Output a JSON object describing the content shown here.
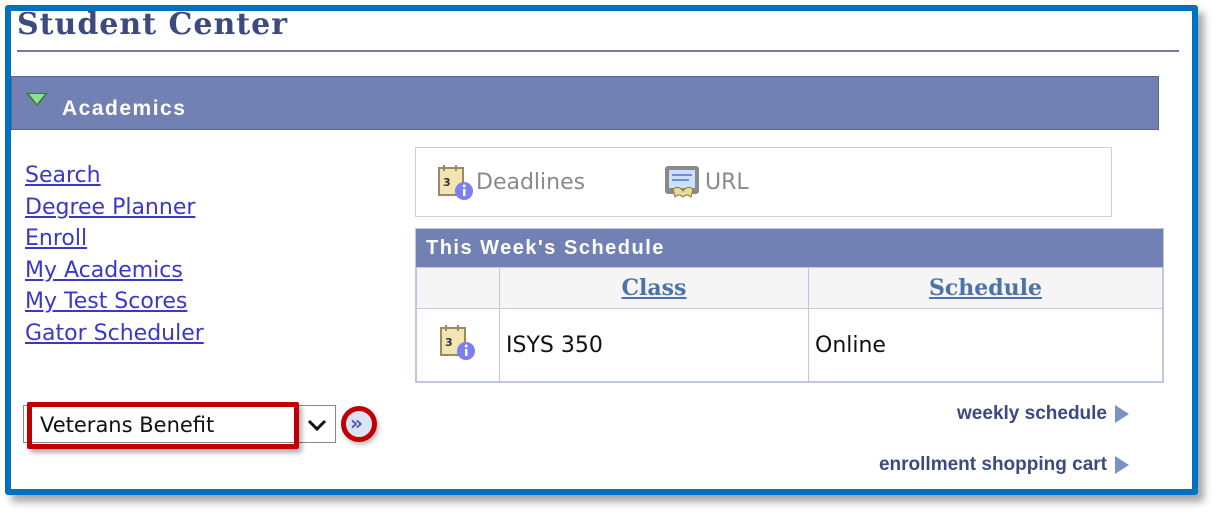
{
  "page": {
    "title": "Student Center"
  },
  "section": {
    "label": "Academics",
    "expanded": true
  },
  "links": [
    {
      "label": "Search"
    },
    {
      "label": "Degree Planner"
    },
    {
      "label": "Enroll"
    },
    {
      "label": "My Academics"
    },
    {
      "label": "My Test Scores"
    },
    {
      "label": "Gator Scheduler"
    }
  ],
  "other_academic": {
    "selected": "Veterans Benefit",
    "go_icon": "double-chevron-right-icon"
  },
  "toolbar": {
    "deadlines_label": "Deadlines",
    "url_label": "URL"
  },
  "schedule": {
    "title": "This Week's Schedule",
    "columns": [
      "",
      "Class",
      "Schedule"
    ],
    "rows": [
      {
        "icon": "calendar-info-icon",
        "class": "ISYS 350",
        "schedule": "Online"
      }
    ]
  },
  "footer": {
    "weekly_schedule": "weekly schedule",
    "shopping_cart": "enrollment shopping cart"
  },
  "colors": {
    "frame_border": "#0070C0",
    "header_bar": "#7281b4",
    "title_text": "#3d4a7d",
    "link": "#3b38c9",
    "highlight": "#c00000"
  }
}
